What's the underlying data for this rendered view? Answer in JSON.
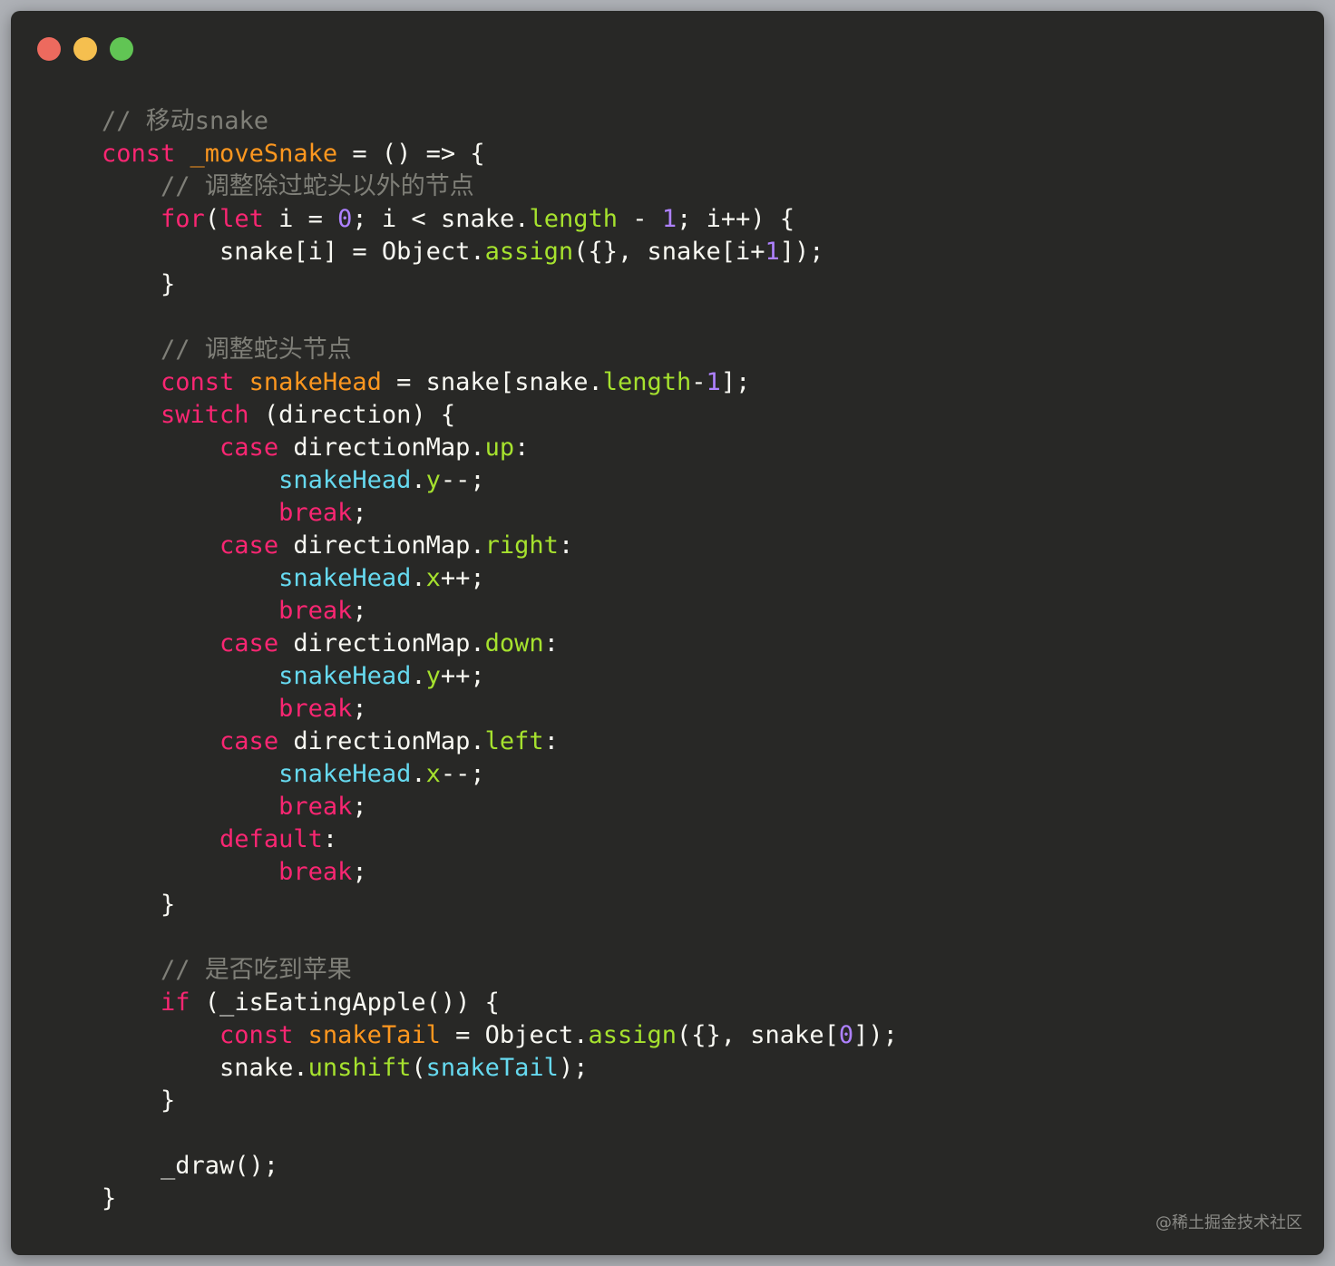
{
  "window": {
    "traffic_lights": [
      {
        "name": "close-dot",
        "color": "#ed6a5e"
      },
      {
        "name": "minimize-dot",
        "color": "#f5bf4f"
      },
      {
        "name": "zoom-dot",
        "color": "#61c554"
      }
    ]
  },
  "colors": {
    "background": "#282826",
    "plain": "#f8f8f2",
    "comment": "#7f7f78",
    "keyword": "#f92672",
    "function": "#fd971f",
    "property": "#a6e22e",
    "number": "#ae81ff",
    "variable": "#66d9ef"
  },
  "code_lines": [
    [
      {
        "t": "// 移动snake",
        "c": "comment"
      }
    ],
    [
      {
        "t": "const ",
        "c": "keyword"
      },
      {
        "t": "_moveSnake",
        "c": "function"
      },
      {
        "t": " = () => {",
        "c": "plain"
      }
    ],
    [
      {
        "t": "    // 调整除过蛇头以外的节点",
        "c": "comment"
      }
    ],
    [
      {
        "t": "    ",
        "c": "plain"
      },
      {
        "t": "for",
        "c": "keyword"
      },
      {
        "t": "(",
        "c": "plain"
      },
      {
        "t": "let",
        "c": "keyword"
      },
      {
        "t": " i = ",
        "c": "plain"
      },
      {
        "t": "0",
        "c": "number"
      },
      {
        "t": "; i < snake.",
        "c": "plain"
      },
      {
        "t": "length",
        "c": "property"
      },
      {
        "t": " - ",
        "c": "plain"
      },
      {
        "t": "1",
        "c": "number"
      },
      {
        "t": "; i++) {",
        "c": "plain"
      }
    ],
    [
      {
        "t": "        snake[i] = Object.",
        "c": "plain"
      },
      {
        "t": "assign",
        "c": "property"
      },
      {
        "t": "({}, snake[i+",
        "c": "plain"
      },
      {
        "t": "1",
        "c": "number"
      },
      {
        "t": "]);",
        "c": "plain"
      }
    ],
    [
      {
        "t": "    }",
        "c": "plain"
      }
    ],
    [],
    [
      {
        "t": "    // 调整蛇头节点",
        "c": "comment"
      }
    ],
    [
      {
        "t": "    ",
        "c": "plain"
      },
      {
        "t": "const ",
        "c": "keyword"
      },
      {
        "t": "snakeHead",
        "c": "function"
      },
      {
        "t": " = snake[snake.",
        "c": "plain"
      },
      {
        "t": "length",
        "c": "property"
      },
      {
        "t": "-",
        "c": "plain"
      },
      {
        "t": "1",
        "c": "number"
      },
      {
        "t": "];",
        "c": "plain"
      }
    ],
    [
      {
        "t": "    ",
        "c": "plain"
      },
      {
        "t": "switch",
        "c": "keyword"
      },
      {
        "t": " (direction) {",
        "c": "plain"
      }
    ],
    [
      {
        "t": "        ",
        "c": "plain"
      },
      {
        "t": "case",
        "c": "keyword"
      },
      {
        "t": " directionMap.",
        "c": "plain"
      },
      {
        "t": "up",
        "c": "property"
      },
      {
        "t": ":",
        "c": "plain"
      }
    ],
    [
      {
        "t": "            ",
        "c": "plain"
      },
      {
        "t": "snakeHead",
        "c": "variable"
      },
      {
        "t": ".",
        "c": "plain"
      },
      {
        "t": "y",
        "c": "property"
      },
      {
        "t": "--;",
        "c": "plain"
      }
    ],
    [
      {
        "t": "            ",
        "c": "plain"
      },
      {
        "t": "break",
        "c": "keyword"
      },
      {
        "t": ";",
        "c": "plain"
      }
    ],
    [
      {
        "t": "        ",
        "c": "plain"
      },
      {
        "t": "case",
        "c": "keyword"
      },
      {
        "t": " directionMap.",
        "c": "plain"
      },
      {
        "t": "right",
        "c": "property"
      },
      {
        "t": ":",
        "c": "plain"
      }
    ],
    [
      {
        "t": "            ",
        "c": "plain"
      },
      {
        "t": "snakeHead",
        "c": "variable"
      },
      {
        "t": ".",
        "c": "plain"
      },
      {
        "t": "x",
        "c": "property"
      },
      {
        "t": "++;",
        "c": "plain"
      }
    ],
    [
      {
        "t": "            ",
        "c": "plain"
      },
      {
        "t": "break",
        "c": "keyword"
      },
      {
        "t": ";",
        "c": "plain"
      }
    ],
    [
      {
        "t": "        ",
        "c": "plain"
      },
      {
        "t": "case",
        "c": "keyword"
      },
      {
        "t": " directionMap.",
        "c": "plain"
      },
      {
        "t": "down",
        "c": "property"
      },
      {
        "t": ":",
        "c": "plain"
      }
    ],
    [
      {
        "t": "            ",
        "c": "plain"
      },
      {
        "t": "snakeHead",
        "c": "variable"
      },
      {
        "t": ".",
        "c": "plain"
      },
      {
        "t": "y",
        "c": "property"
      },
      {
        "t": "++;",
        "c": "plain"
      }
    ],
    [
      {
        "t": "            ",
        "c": "plain"
      },
      {
        "t": "break",
        "c": "keyword"
      },
      {
        "t": ";",
        "c": "plain"
      }
    ],
    [
      {
        "t": "        ",
        "c": "plain"
      },
      {
        "t": "case",
        "c": "keyword"
      },
      {
        "t": " directionMap.",
        "c": "plain"
      },
      {
        "t": "left",
        "c": "property"
      },
      {
        "t": ":",
        "c": "plain"
      }
    ],
    [
      {
        "t": "            ",
        "c": "plain"
      },
      {
        "t": "snakeHead",
        "c": "variable"
      },
      {
        "t": ".",
        "c": "plain"
      },
      {
        "t": "x",
        "c": "property"
      },
      {
        "t": "--;",
        "c": "plain"
      }
    ],
    [
      {
        "t": "            ",
        "c": "plain"
      },
      {
        "t": "break",
        "c": "keyword"
      },
      {
        "t": ";",
        "c": "plain"
      }
    ],
    [
      {
        "t": "        ",
        "c": "plain"
      },
      {
        "t": "default",
        "c": "keyword"
      },
      {
        "t": ":",
        "c": "plain"
      }
    ],
    [
      {
        "t": "            ",
        "c": "plain"
      },
      {
        "t": "break",
        "c": "keyword"
      },
      {
        "t": ";",
        "c": "plain"
      }
    ],
    [
      {
        "t": "    }",
        "c": "plain"
      }
    ],
    [],
    [
      {
        "t": "    // 是否吃到苹果",
        "c": "comment"
      }
    ],
    [
      {
        "t": "    ",
        "c": "plain"
      },
      {
        "t": "if",
        "c": "keyword"
      },
      {
        "t": " (_isEatingApple()) {",
        "c": "plain"
      }
    ],
    [
      {
        "t": "        ",
        "c": "plain"
      },
      {
        "t": "const ",
        "c": "keyword"
      },
      {
        "t": "snakeTail",
        "c": "function"
      },
      {
        "t": " = Object.",
        "c": "plain"
      },
      {
        "t": "assign",
        "c": "property"
      },
      {
        "t": "({}, snake[",
        "c": "plain"
      },
      {
        "t": "0",
        "c": "number"
      },
      {
        "t": "]);",
        "c": "plain"
      }
    ],
    [
      {
        "t": "        snake.",
        "c": "plain"
      },
      {
        "t": "unshift",
        "c": "property"
      },
      {
        "t": "(",
        "c": "plain"
      },
      {
        "t": "snakeTail",
        "c": "variable"
      },
      {
        "t": ");",
        "c": "plain"
      }
    ],
    [
      {
        "t": "    }",
        "c": "plain"
      }
    ],
    [],
    [
      {
        "t": "    _draw();",
        "c": "plain"
      }
    ],
    [
      {
        "t": "}",
        "c": "plain"
      }
    ]
  ],
  "watermark": "@稀土掘金技术社区"
}
